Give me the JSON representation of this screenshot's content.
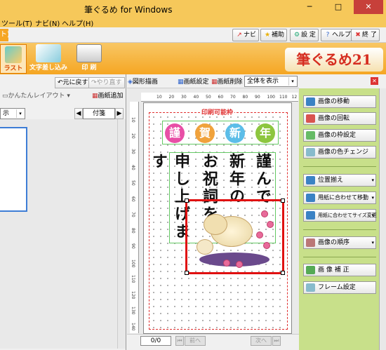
{
  "window": {
    "title": "筆ぐるめ for Windows",
    "close_label": "✕"
  },
  "menu": {
    "items": [
      "ツール(T)",
      "ナビ(N)",
      "ヘルプ(H)"
    ]
  },
  "toolbar": {
    "left_tab": "ト)",
    "navi": "ナビ",
    "hojo": "補助",
    "settei": "設 定",
    "help": "ヘルプ",
    "exit": "終 了"
  },
  "ribbon": {
    "illust": "ラスト",
    "letters": "文字差し込み",
    "print": "印 刷",
    "logo": "筆ぐるめ21"
  },
  "left_panel": {
    "undo": "元に戻す",
    "redo": "やり直す",
    "layout": "かんたんレイアウト",
    "add_sheet": "画紙追加",
    "view_select": "示",
    "sticky": "付箋"
  },
  "center": {
    "shape_draw": "図形描画",
    "sheet_settings": "画紙設定",
    "sheet_delete": "画紙削除",
    "zoom": "全体を表示",
    "print_area": "印刷可能枠",
    "page": "0/0",
    "prev": "前へ",
    "next": "次へ",
    "greeting": [
      "謹",
      "賀",
      "新",
      "年"
    ],
    "greeting_colors": [
      "#e84fa6",
      "#f0a23c",
      "#5cbde8",
      "#8dc63f"
    ],
    "message_cols": [
      "謹んで",
      "新年の",
      "お祝詞を",
      "申し上げます"
    ]
  },
  "ruler": {
    "h_ticks": [
      "10",
      "20",
      "30",
      "40",
      "50",
      "60",
      "70",
      "80",
      "90",
      "100",
      "110",
      "12"
    ],
    "v_ticks": [
      "10",
      "20",
      "30",
      "40",
      "50",
      "60",
      "70",
      "80",
      "90",
      "100",
      "110",
      "120",
      "130",
      "140"
    ]
  },
  "right_panel": {
    "buttons": [
      "画像の移動",
      "画像の回転",
      "画像の枠設定",
      "画像の色チェンジ"
    ],
    "group2": [
      "位置揃え",
      "用紙に合わせて移動",
      "用紙に合わせてサイズ変更"
    ],
    "order": "画像の順序",
    "correct": "画 像 補 正",
    "frame": "フレーム設定"
  }
}
